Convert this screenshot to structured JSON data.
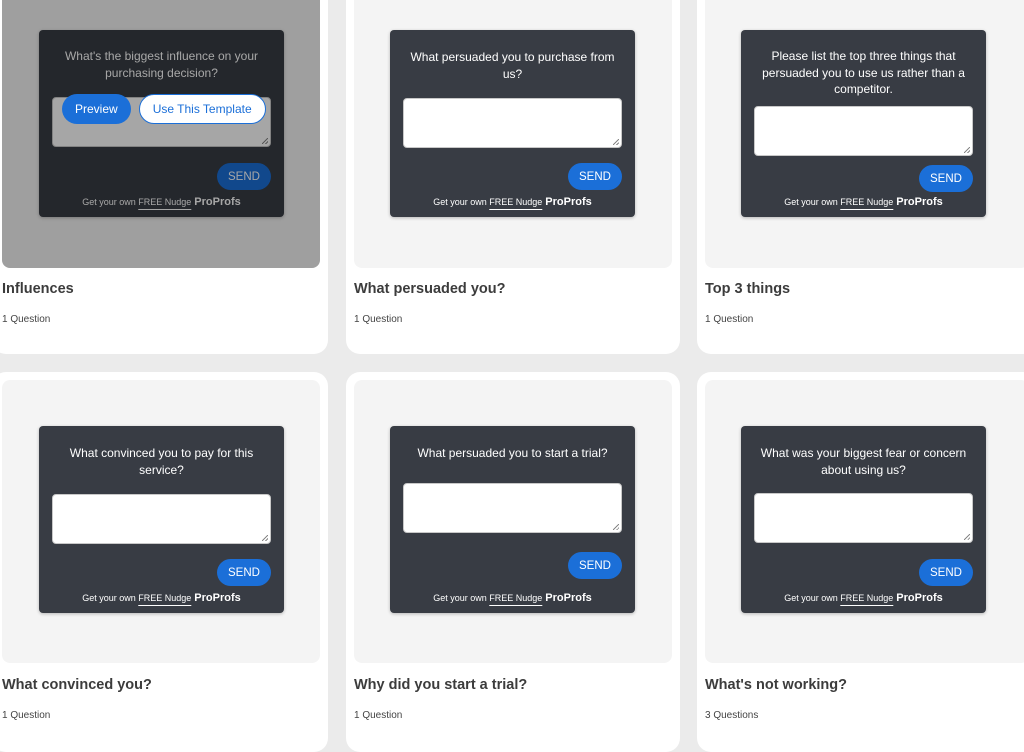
{
  "hover_actions": {
    "preview_label": "Preview",
    "use_label": "Use This Template"
  },
  "widget_common": {
    "send_label": "SEND",
    "footer_prefix": "Get your own ",
    "footer_free": "FREE Nudge",
    "brand": "ProProfs"
  },
  "colors": {
    "accent": "#1b6fd8",
    "widget_bg": "#383c44",
    "page_bg": "#ebebeb"
  },
  "templates": [
    {
      "question": "What's the biggest influence on your purchasing decision?",
      "title": "Influences",
      "count": "1 Question"
    },
    {
      "question": "What persuaded you to purchase from us?",
      "title": "What persuaded you?",
      "count": "1 Question"
    },
    {
      "question": "Please list the top three things that persuaded you to use us rather than a competitor.",
      "title": "Top 3 things",
      "count": "1 Question"
    },
    {
      "question": "What convinced you to pay for this service?",
      "title": "What convinced you?",
      "count": "1 Question"
    },
    {
      "question": "What persuaded you to start a trial?",
      "title": "Why did you start a trial?",
      "count": "1 Question"
    },
    {
      "question": "What was your biggest fear or concern about using us?",
      "title": "What's not working?",
      "count": "3 Questions"
    }
  ]
}
